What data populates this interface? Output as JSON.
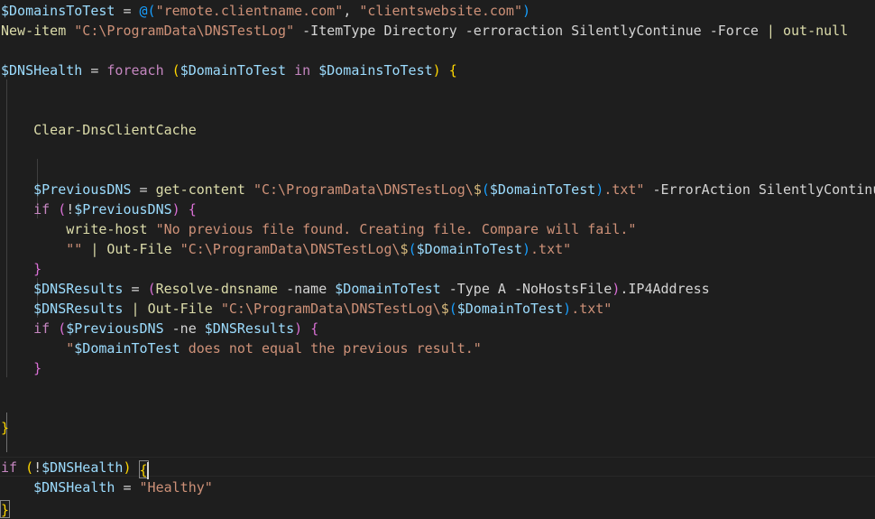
{
  "editor": {
    "language": "PowerShell",
    "theme": "Dark+ (default dark)",
    "background_color": "#1e1e1e",
    "foreground_color": "#d4d4d4",
    "line_height_px": 22,
    "font_size_px": 15,
    "current_line_index": 19,
    "cursor_line_index": 19,
    "cursor_column": 20,
    "colors": {
      "variable": "#9cdcfe",
      "keyword": "#c586c0",
      "string": "#ce9178",
      "function": "#dcdcaa",
      "plain": "#d4d4d4",
      "bracket_level1": "#ffd700",
      "bracket_level2": "#da70d6",
      "bracket_level3": "#179fff",
      "escape": "#d7ba7d",
      "indent_guide": "#404040",
      "indent_guide_active": "#707070",
      "current_line_border": "#282828",
      "bracket_match_border": "#888888"
    },
    "lines": [
      "$DomainsToTest = @(\"remote.clientname.com\", \"clientswebsite.com\")",
      "New-item \"C:\\ProgramData\\DNSTestLog\" -ItemType Directory -erroraction SilentlyContinue -Force | out-null",
      "",
      "$DNSHealth = foreach ($DomainToTest in $DomainsToTest) {",
      "",
      "",
      "    Clear-DnsClientCache",
      "",
      "",
      "    $PreviousDNS = get-content \"C:\\ProgramData\\DNSTestLog\\$($DomainToTest).txt\" -ErrorAction SilentlyContinue",
      "    if (!$PreviousDNS) {",
      "        write-host \"No previous file found. Creating file. Compare will fail.\"",
      "        \"\" | Out-File \"C:\\ProgramData\\DNSTestLog\\$($DomainToTest).txt\"",
      "    }",
      "    $DNSResults = (Resolve-dnsname -name $DomainToTest -Type A -NoHostsFile).IP4Address",
      "    $DNSResults | Out-File \"C:\\ProgramData\\DNSTestLog\\$($DomainToTest).txt\"",
      "    if ($PreviousDNS -ne $DNSResults) {",
      "        \"$DomainToTest does not equal the previous result.\"",
      "    }",
      "",
      "",
      "}",
      "",
      "if (!$DNSHealth) {",
      "    $DNSHealth = \"Healthy\"",
      "}"
    ]
  }
}
